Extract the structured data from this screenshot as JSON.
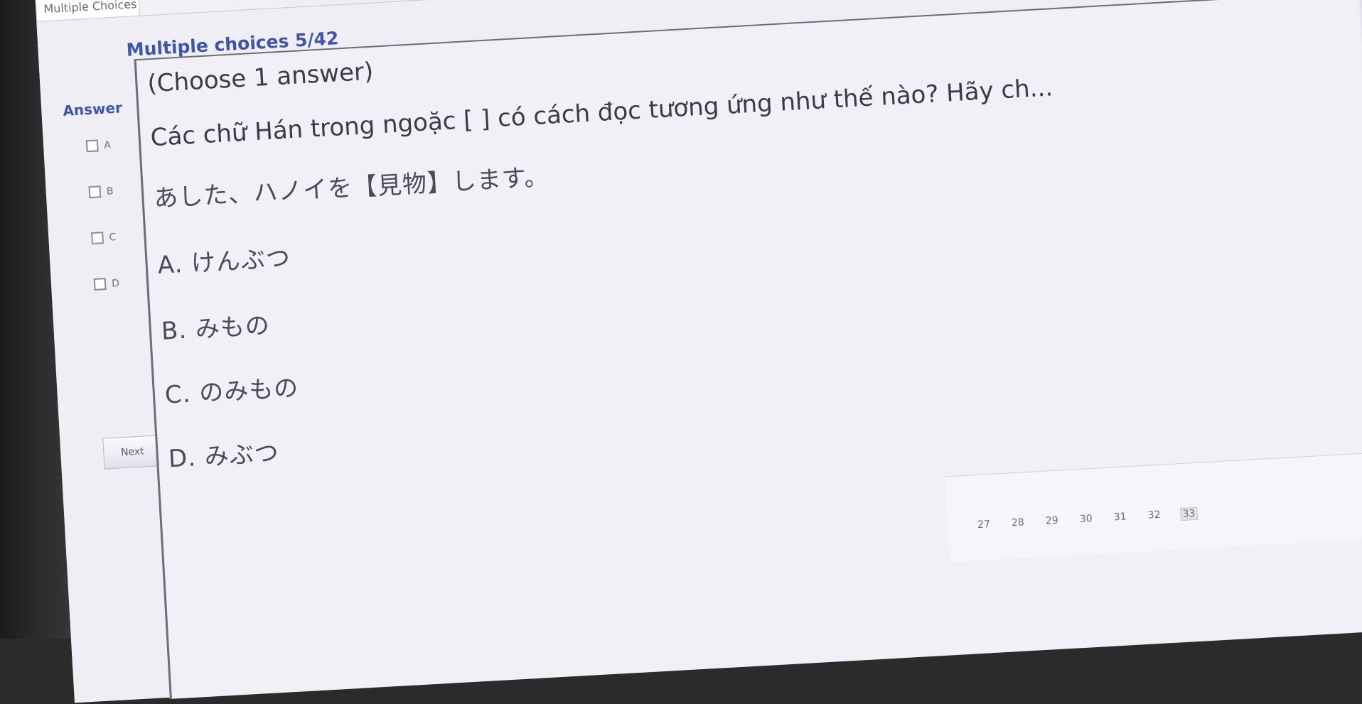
{
  "window": {
    "tab_label": "Multiple Choices"
  },
  "quiz": {
    "progress_label": "Multiple choices 5/42",
    "answer_label": "Answer",
    "options": [
      {
        "letter": "A"
      },
      {
        "letter": "B"
      },
      {
        "letter": "C"
      },
      {
        "letter": "D"
      }
    ],
    "next_label": "Next"
  },
  "question": {
    "instruction": "(Choose 1 answer)",
    "prompt": "Các chữ Hán trong ngoặc [    ] có cách đọc tương ứng như thế nào? Hãy ch...",
    "sentence": "あした、ハノイを【見物】します。",
    "choices": [
      "A. けんぶつ",
      "B. みもの",
      "C. のみもの",
      "D. みぶつ"
    ]
  },
  "pager": {
    "pages": [
      "27",
      "28",
      "29",
      "30",
      "31",
      "32",
      "33"
    ]
  }
}
